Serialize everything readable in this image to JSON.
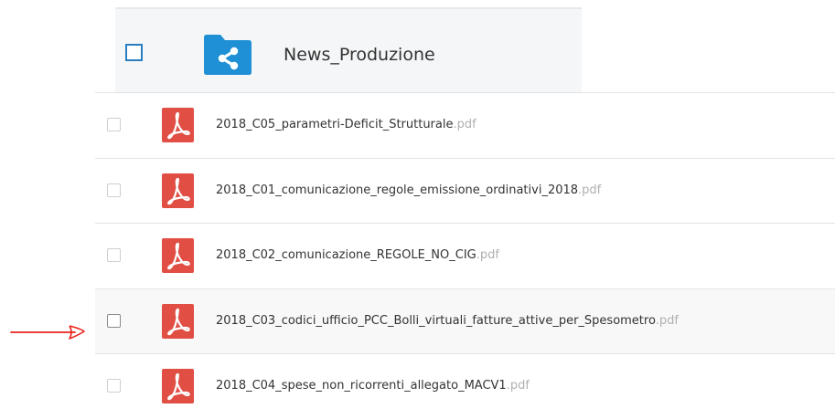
{
  "folder": {
    "name": "News_Produzione",
    "icon": "shared-folder-icon",
    "color": "#1f8fd6"
  },
  "file_icon": "pdf-icon",
  "pdf_color": "#e04e44",
  "files": [
    {
      "name": "2018_C05_parametri-Deficit_Strutturale",
      "ext": ".pdf"
    },
    {
      "name": "2018_C01_comunicazione_regole_emissione_ordinativi_2018",
      "ext": ".pdf"
    },
    {
      "name": "2018_C02_comunicazione_REGOLE_NO_CIG",
      "ext": ".pdf"
    },
    {
      "name": "2018_C03_codici_ufficio_PCC_Bolli_virtuali_fatture_attive_per_Spesometro",
      "ext": ".pdf",
      "highlighted": true
    },
    {
      "name": "2018_C04_spese_non_ricorrenti_allegato_MACV1",
      "ext": ".pdf"
    }
  ],
  "annotation": {
    "icon": "arrow-icon",
    "color": "#e8261f"
  }
}
